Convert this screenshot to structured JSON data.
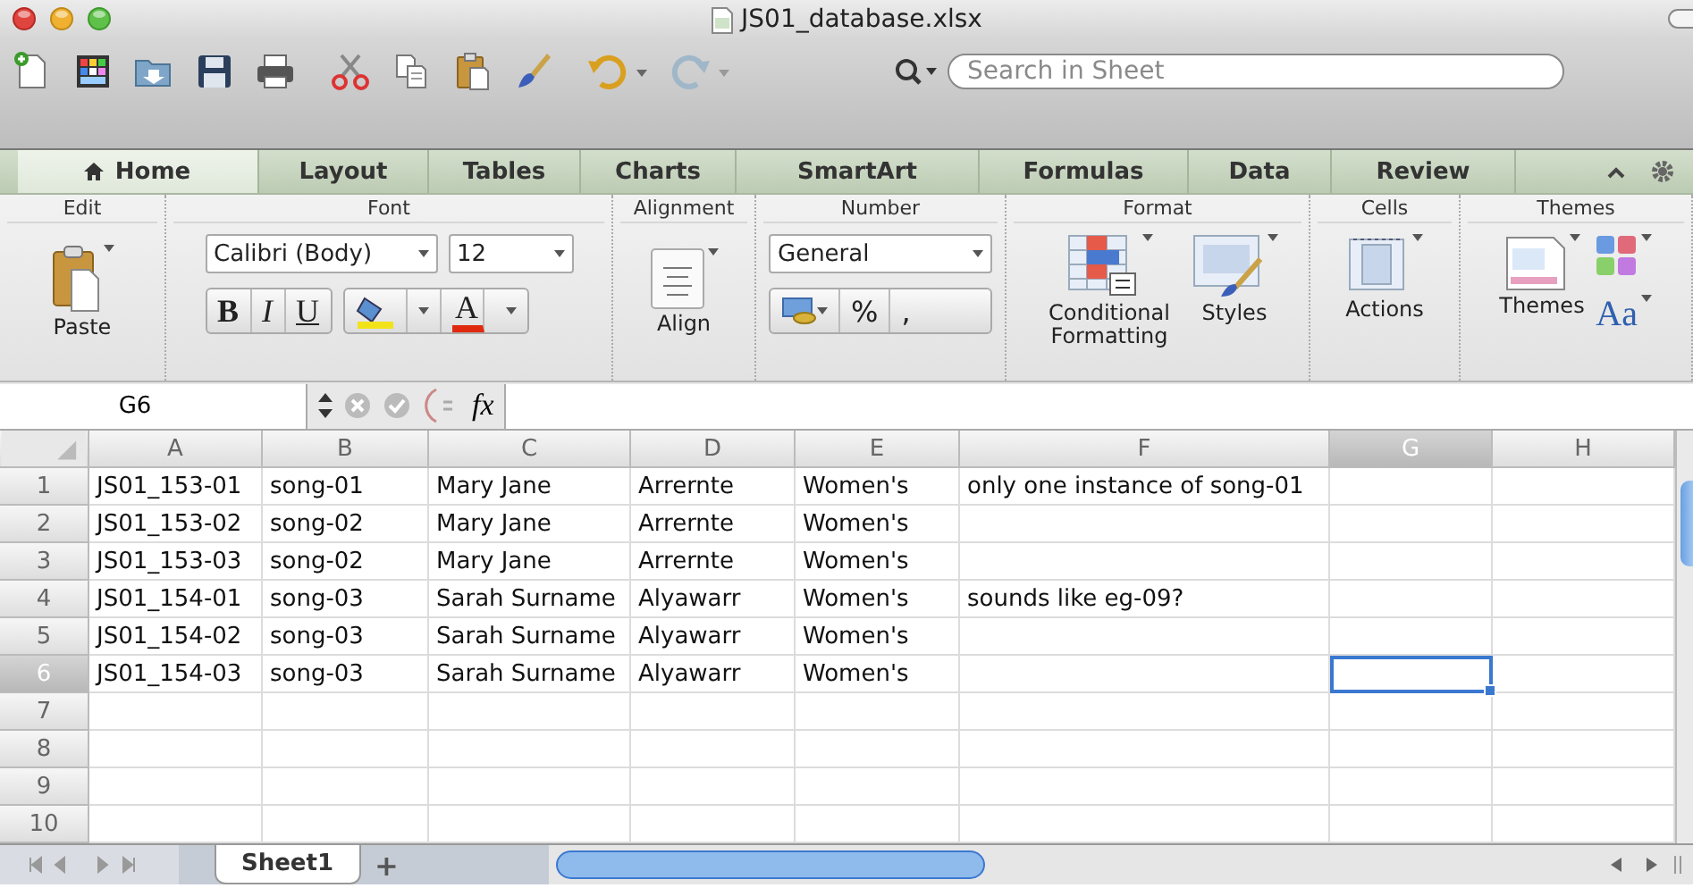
{
  "window": {
    "title": "JS01_database.xlsx"
  },
  "search": {
    "placeholder": "Search in Sheet"
  },
  "tabs": [
    {
      "label": "Home",
      "selected": true
    },
    {
      "label": "Layout",
      "selected": false
    },
    {
      "label": "Tables",
      "selected": false
    },
    {
      "label": "Charts",
      "selected": false
    },
    {
      "label": "SmartArt",
      "selected": false
    },
    {
      "label": "Formulas",
      "selected": false
    },
    {
      "label": "Data",
      "selected": false
    },
    {
      "label": "Review",
      "selected": false
    }
  ],
  "ribbon": {
    "groups": [
      {
        "kind": "edit",
        "label": "Edit",
        "paste": "Paste"
      },
      {
        "kind": "font",
        "label": "Font",
        "font_name": "Calibri (Body)",
        "font_size": "12",
        "bold": "B",
        "italic": "I",
        "underline": "U",
        "font_color": "A"
      },
      {
        "kind": "alignment",
        "label": "Alignment",
        "align": "Align"
      },
      {
        "kind": "number",
        "label": "Number",
        "format": "General",
        "percent": "%",
        "comma": ","
      },
      {
        "kind": "format",
        "label": "Format",
        "conditional": "Conditional Formatting",
        "styles": "Styles"
      },
      {
        "kind": "cells",
        "label": "Cells",
        "actions": "Actions"
      },
      {
        "kind": "themes",
        "label": "Themes",
        "themes": "Themes",
        "theme_fonts": "Aa"
      }
    ]
  },
  "formula_bar": {
    "name_box": "G6",
    "function_symbol": "fx"
  },
  "columns": [
    {
      "label": "A",
      "selected": false
    },
    {
      "label": "B",
      "selected": false
    },
    {
      "label": "C",
      "selected": false
    },
    {
      "label": "D",
      "selected": false
    },
    {
      "label": "E",
      "selected": false
    },
    {
      "label": "F",
      "selected": false
    },
    {
      "label": "G",
      "selected": true
    },
    {
      "label": "H",
      "selected": false
    }
  ],
  "rows": [
    {
      "number": "1",
      "selected": false,
      "cells": [
        "JS01_153-01",
        "song-01",
        "Mary Jane",
        "Arrernte",
        "Women's",
        "only one instance of song-01"
      ]
    },
    {
      "number": "2",
      "selected": false,
      "cells": [
        "JS01_153-02",
        "song-02",
        "Mary Jane",
        "Arrernte",
        "Women's"
      ]
    },
    {
      "number": "3",
      "selected": false,
      "cells": [
        "JS01_153-03",
        "song-02",
        "Mary Jane",
        "Arrernte",
        "Women's"
      ]
    },
    {
      "number": "4",
      "selected": false,
      "cells": [
        "JS01_154-01",
        "song-03",
        "Sarah Surname",
        "Alyawarr",
        "Women's",
        "sounds like eg-09?"
      ]
    },
    {
      "number": "5",
      "selected": false,
      "cells": [
        "JS01_154-02",
        "song-03",
        "Sarah Surname",
        "Alyawarr",
        "Women's"
      ]
    },
    {
      "number": "6",
      "selected": true,
      "cells": [
        "JS01_154-03",
        "song-03",
        "Sarah Surname",
        "Alyawarr",
        "Women's"
      ]
    },
    {
      "number": "7",
      "selected": false
    },
    {
      "number": "8",
      "selected": false
    },
    {
      "number": "9",
      "selected": false
    },
    {
      "number": "10",
      "selected": false
    }
  ],
  "sheet_tabs": [
    {
      "label": "Sheet1",
      "selected": true
    }
  ],
  "add_sheet": "+"
}
